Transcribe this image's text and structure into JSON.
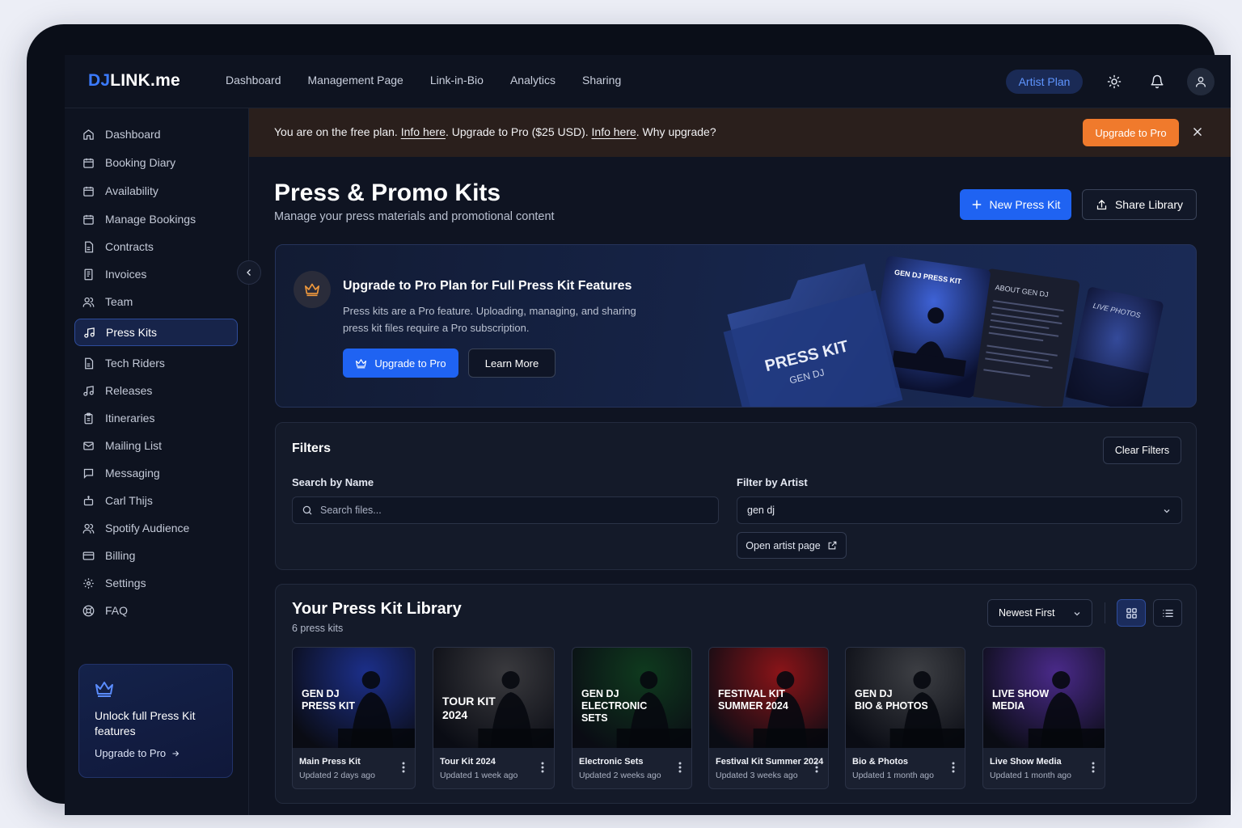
{
  "brand": {
    "logo_dj": "DJ",
    "logo_rest": "LINK.me"
  },
  "topnav": {
    "links": [
      "Dashboard",
      "Management Page",
      "Link-in-Bio",
      "Analytics",
      "Sharing"
    ],
    "plan_badge": "Artist Plan",
    "icons": [
      "sun-icon",
      "bell-icon",
      "user-icon"
    ]
  },
  "sidebar": {
    "items": [
      {
        "label": "Dashboard",
        "icon": "home-icon"
      },
      {
        "label": "Booking Diary",
        "icon": "calendar-icon"
      },
      {
        "label": "Availability",
        "icon": "calendar-icon"
      },
      {
        "label": "Manage Bookings",
        "icon": "calendar-icon"
      },
      {
        "label": "Contracts",
        "icon": "document-icon"
      },
      {
        "label": "Invoices",
        "icon": "receipt-icon"
      },
      {
        "label": "Team",
        "icon": "users-icon"
      },
      {
        "label": "Press Kits",
        "icon": "music-note-icon",
        "active": true
      },
      {
        "label": "Tech Riders",
        "icon": "document-icon"
      },
      {
        "label": "Releases",
        "icon": "music-note-icon"
      },
      {
        "label": "Itineraries",
        "icon": "clipboard-icon"
      },
      {
        "label": "Mailing List",
        "icon": "mail-icon"
      },
      {
        "label": "Messaging",
        "icon": "chat-icon"
      },
      {
        "label": "Carl Thijs",
        "icon": "robot-icon"
      },
      {
        "label": "Spotify Audience",
        "icon": "users-icon"
      },
      {
        "label": "Billing",
        "icon": "credit-card-icon"
      },
      {
        "label": "Settings",
        "icon": "gear-icon"
      },
      {
        "label": "FAQ",
        "icon": "help-icon"
      }
    ],
    "promo": {
      "title": "Unlock full Press Kit features",
      "link": "Upgrade to Pro"
    }
  },
  "banner": {
    "text_1": "You are on the free plan. ",
    "link_1": "Info here",
    "text_2": ". Upgrade to Pro ($25 USD). ",
    "link_2": "Info here",
    "text_3": ". Why upgrade?",
    "button": "Upgrade to Pro"
  },
  "header": {
    "title": "Press & Promo Kits",
    "subtitle": "Manage your press materials and promotional content",
    "new_button": "New Press Kit",
    "share_button": "Share Library"
  },
  "upgrade_panel": {
    "title": "Upgrade to Pro Plan for Full Press Kit Features",
    "description": "Press kits are a Pro feature. Uploading, managing, and sharing press kit files require a Pro subscription.",
    "primary_button": "Upgrade to Pro",
    "secondary_button": "Learn More",
    "art": {
      "folder_title": "PRESS KIT",
      "folder_sub": "GEN DJ",
      "card1": "GEN DJ PRESS KIT",
      "card2": "ABOUT GEN DJ",
      "card3": "LIVE PHOTOS"
    }
  },
  "filters": {
    "title": "Filters",
    "clear_button": "Clear Filters",
    "search_label": "Search by Name",
    "search_placeholder": "Search files...",
    "artist_label": "Filter by Artist",
    "artist_value": "gen dj",
    "open_artist": "Open artist page"
  },
  "library": {
    "title": "Your Press Kit Library",
    "count": "6 press kits",
    "sort": "Newest First",
    "kits": [
      {
        "thumb_text": "GEN DJ\nPRESS KIT",
        "name": "Main Press Kit",
        "updated": "Updated 2 days ago",
        "color": "#1c2f8a"
      },
      {
        "thumb_text": "TOUR KIT\n2024",
        "name": "Tour Kit 2024",
        "updated": "Updated 1 week ago",
        "color": "#3a3a3e"
      },
      {
        "thumb_text": "GEN DJ\nELECTRONIC\nSETS",
        "name": "Electronic Sets",
        "updated": "Updated 2 weeks ago",
        "color": "#0f3a1e"
      },
      {
        "thumb_text": "FESTIVAL KIT\nSUMMER 2024",
        "name": "Festival Kit Summer 2024",
        "updated": "Updated 3 weeks ago",
        "color": "#8a1418"
      },
      {
        "thumb_text": "GEN DJ\nBIO & PHOTOS",
        "name": "Bio & Photos",
        "updated": "Updated 1 month ago",
        "color": "#3d3f44"
      },
      {
        "thumb_text": "LIVE SHOW\nMEDIA",
        "name": "Live Show Media",
        "updated": "Updated 1 month ago",
        "color": "#4a2a8a"
      }
    ]
  },
  "colors": {
    "accent": "#1f63f2",
    "orange": "#f07a2c",
    "background": "#0f1422"
  }
}
